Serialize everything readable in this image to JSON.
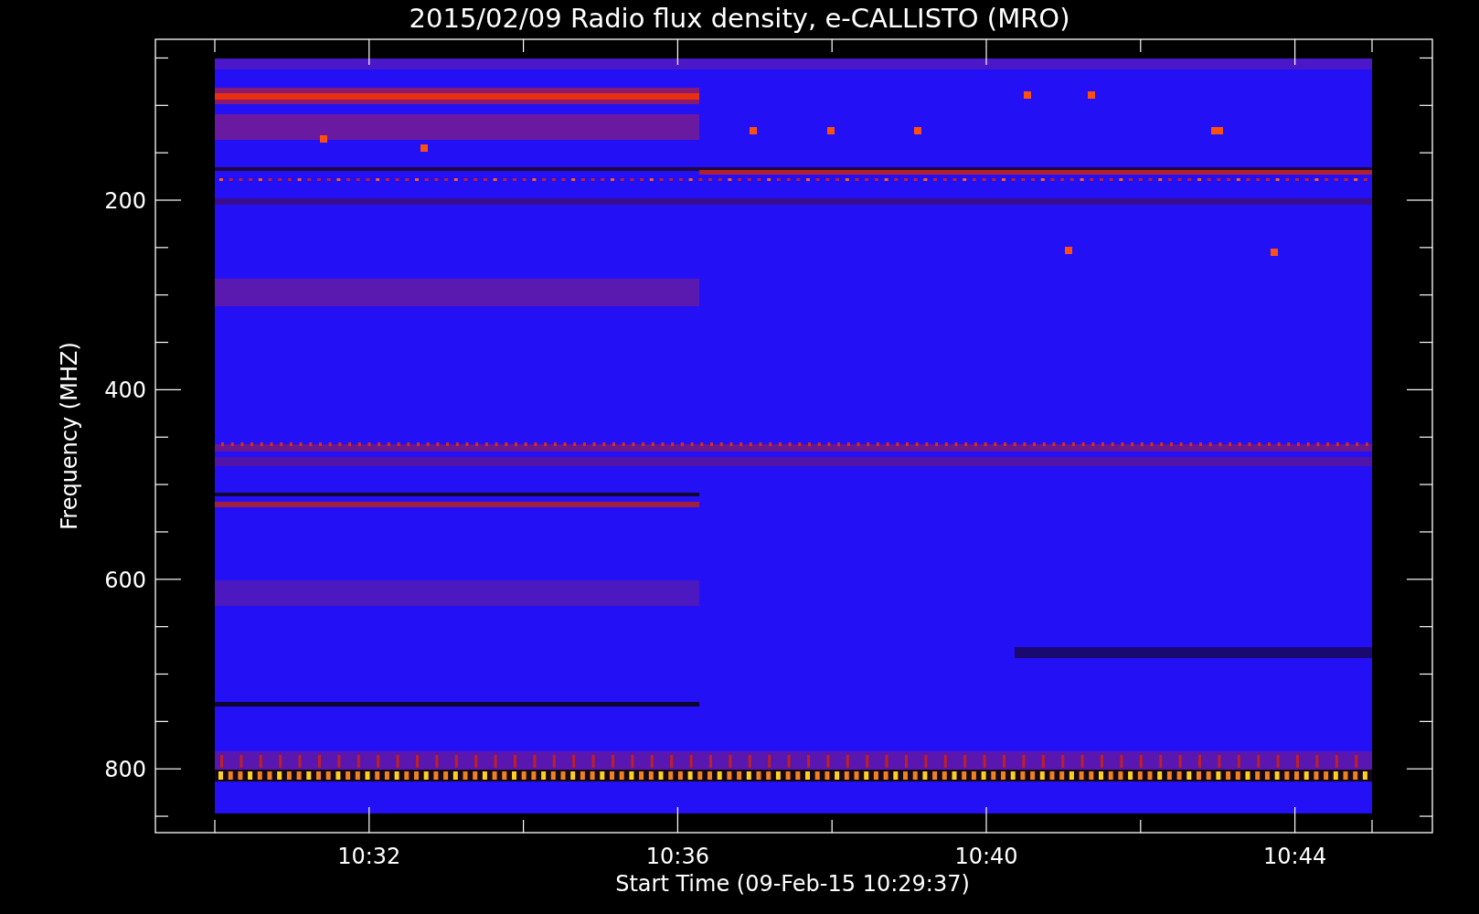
{
  "title": "2015/02/09  Radio flux density, e-CALLISTO (MRO)",
  "y_axis": {
    "label": "Frequency (MHZ)",
    "ticks": [
      "200",
      "400",
      "600",
      "800"
    ]
  },
  "x_axis": {
    "label": "Start Time (09-Feb-15 10:29:37)",
    "ticks": [
      "10:32",
      "10:36",
      "10:40",
      "10:44"
    ]
  }
}
